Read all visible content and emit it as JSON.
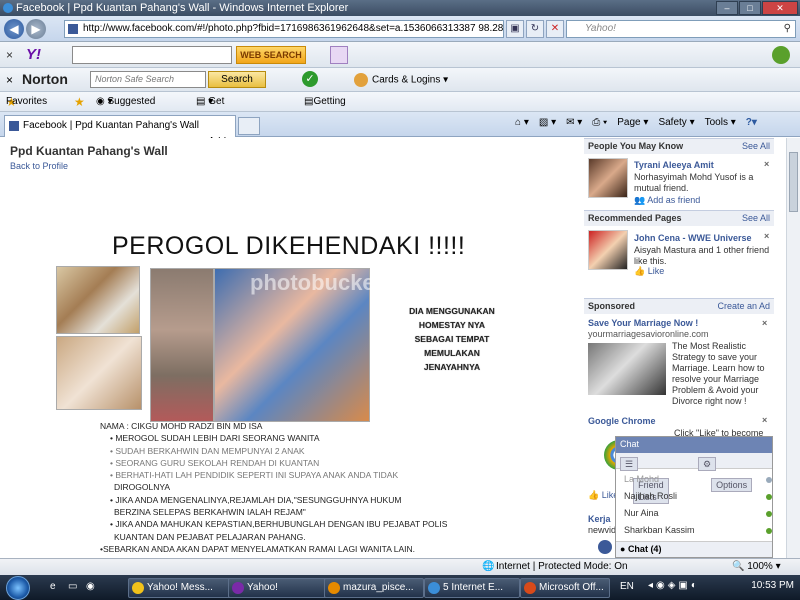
{
  "window": {
    "title": "Facebook | Ppd Kuantan Pahang's Wall - Windows Internet Explorer"
  },
  "address": {
    "url": "http://www.facebook.com/#!/photo.php?fbid=1716986361962648&set=a.1536066313387 98.28204.100"
  },
  "yahoo_search": {
    "placeholder": "Yahoo!"
  },
  "yahoo_toolbar": {
    "logo": "Y!",
    "button": "WEB SEARCH"
  },
  "norton_toolbar": {
    "logo": "Norton",
    "placeholder": "Norton Safe Search",
    "search_label": "Search",
    "cards_label": "Cards & Logins"
  },
  "favorites": {
    "label": "Favorites",
    "items": [
      "Suggested Sites",
      "Get More Add-ons",
      "Getting Started"
    ]
  },
  "tab": {
    "label": "Facebook | Ppd Kuantan Pahang's Wall"
  },
  "commands": [
    "Page",
    "Safety",
    "Tools"
  ],
  "page": {
    "title": "Ppd Kuantan Pahang's Wall",
    "back": "Back to Profile",
    "headline": "PEROGOL DIKEHENDAKI !!!!!",
    "watermark": "photobucket",
    "side_text": [
      "DIA MENGGUNAKAN",
      "HOMESTAY NYA",
      "SEBAGAI TEMPAT",
      "MEMULAKAN",
      "JENAYAHNYA"
    ],
    "details": [
      "NAMA : CIKGU MOHD RADZI BIN MD ISA",
      "MEROGOL SUDAH LEBIH DARI SEORANG WANITA",
      "SUDAH BERKAHWIN  DAN MEMPUNYAI 2 ANAK",
      "SEORANG GURU SEKOLAH RENDAH DI KUANTAN",
      "BERHATI-HATI LAH PENDIDIK  SEPERTI INI SUPAYA ANAK ANDA TIDAK",
      "DIROGOLNYA",
      "JIKA ANDA MENGENALINYA,REJAMLAH  DIA,\"SESUNGGUHNYA HUKUM",
      "BERZINA SELEPAS BERKAHWIN IALAH REJAM\"",
      "JIKA ANDA MAHUKAN KEPASTIAN,BERHUBUNGLAH  DENGAN IBU PEJABAT POLIS",
      "KUANTAN DAN PEJABAT PELAJARAN  PAHANG.",
      "•SEBARKAN ANDA AKAN DAPAT MENYELAMATKAN  RAMAI LAGI WANITA LAIN."
    ]
  },
  "sidebar": {
    "pymk": {
      "header": "People You May Know",
      "see_all": "See All",
      "name": "Tyrani Aleeya Amit",
      "text": "Norhasyimah Mohd Yusof is a mutual friend.",
      "action": "Add as friend"
    },
    "recommended": {
      "header": "Recommended Pages",
      "see_all": "See All",
      "name": "John Cena - WWE Universe",
      "text": "Aisyah Mastura and 1 other friend like this.",
      "action": "Like"
    },
    "sponsored": {
      "header": "Sponsored",
      "create": "Create an Ad",
      "ad_title": "Save Your Marriage Now !",
      "ad_url": "yourmarriagesavioronline.com",
      "ad_text": "The Most Realistic Strategy to save your Marriage. Learn how to resolve your Marriage Problem & Avoid your Divorce right now !"
    },
    "chrome": {
      "title": "Google Chrome",
      "text": "Click \"Like\" to become",
      "like": "Like",
      "kerja": "Kerja",
      "newvid": "newvid"
    }
  },
  "chat": {
    "header": "Chat",
    "tabs": [
      "Friend Lists",
      "Options"
    ],
    "friends": [
      "La Mohd",
      "Najihah Rosli",
      "Nur Aina",
      "Sharkban Kassim"
    ],
    "footer": "Chat (4)"
  },
  "status": {
    "zone": "Internet | Protected Mode: On",
    "zoom": "100%"
  },
  "taskbar": {
    "tasks": [
      "Yahoo! Mess...",
      "Yahoo!",
      "mazura_pisce...",
      "5 Internet E...",
      "Microsoft Off..."
    ],
    "lang": "EN",
    "time": "10:53 PM"
  }
}
